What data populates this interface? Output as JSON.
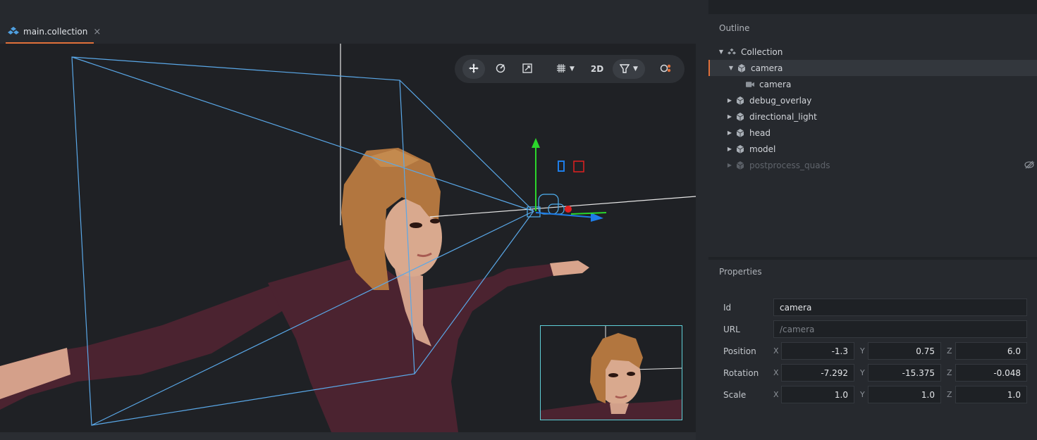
{
  "tab": {
    "label": "main.collection",
    "close": "×"
  },
  "toolbar": {
    "mode_2d": "2D"
  },
  "outline": {
    "title": "Outline",
    "items": [
      {
        "label": "Collection"
      },
      {
        "label": "camera"
      },
      {
        "label": "camera"
      },
      {
        "label": "debug_overlay"
      },
      {
        "label": "directional_light"
      },
      {
        "label": "head"
      },
      {
        "label": "model"
      },
      {
        "label": "postprocess_quads"
      }
    ]
  },
  "properties": {
    "title": "Properties",
    "id": {
      "label": "Id",
      "value": "camera"
    },
    "url": {
      "label": "URL",
      "placeholder": "/camera"
    },
    "position": {
      "label": "Position",
      "x": "-1.3",
      "y": "0.75",
      "z": "6.0"
    },
    "rotation": {
      "label": "Rotation",
      "x": "-7.292",
      "y": "-15.375",
      "z": "-0.048"
    },
    "scale": {
      "label": "Scale",
      "x": "1.0",
      "y": "1.0",
      "z": "1.0"
    },
    "axes": {
      "x": "X",
      "y": "Y",
      "z": "Z"
    }
  },
  "colors": {
    "accent": "#e0703a",
    "frustum": "#5aa8e8",
    "preview_border": "#5fd0d8",
    "gizmo_y": "#2bd62b",
    "gizmo_x": "#e02020",
    "gizmo_z": "#1e7de8"
  }
}
